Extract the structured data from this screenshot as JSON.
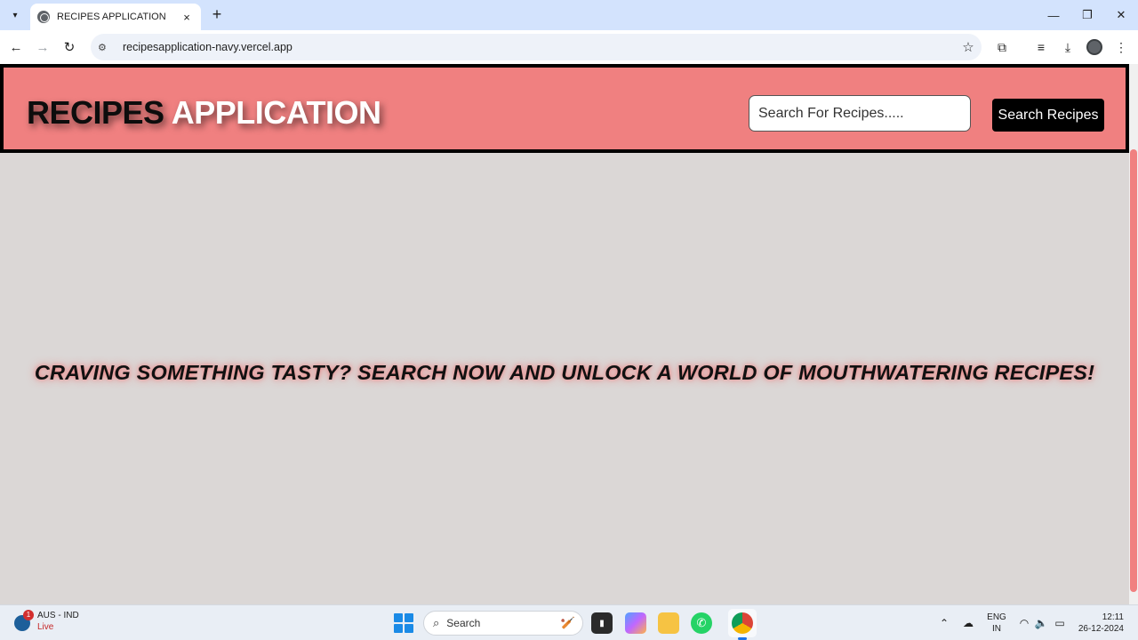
{
  "browser": {
    "tab_title": "RECIPES APPLICATION",
    "tab_close": "×",
    "new_tab": "+",
    "url": "recipesapplication-navy.vercel.app",
    "icons": [
      "tab-list-icon",
      "globe-icon",
      "back-icon",
      "forward-icon",
      "reload-icon",
      "site-settings-icon",
      "star-icon",
      "extensions-icon",
      "media-icon",
      "download-icon",
      "profile-icon",
      "menu-icon",
      "minimize-icon",
      "maximize-icon",
      "close-icon"
    ]
  },
  "app": {
    "brand_part1": "RECIPES",
    "brand_part2": "APPLICATION",
    "search_placeholder": "Search For Recipes.....",
    "search_button": "Search Recipes",
    "tagline": "CRAVING SOMETHING TASTY? SEARCH NOW AND UNLOCK A WORLD OF MOUTHWATERING RECIPES!",
    "colors": {
      "header_bg": "#f08080",
      "page_bg": "#dbd7d6",
      "button_bg": "#000000",
      "brand_dark": "#0d0d0d",
      "brand_light": "#ffffff"
    }
  },
  "taskbar": {
    "widget_badge": "1",
    "widget_title": "AUS - IND",
    "widget_status": "Live",
    "search_label": "Search",
    "language_line1": "ENG",
    "language_line2": "IN",
    "time": "12:11",
    "date": "26-12-2024",
    "apps": [
      "start-icon",
      "terminal-icon",
      "copilot-icon",
      "file-explorer-icon",
      "whatsapp-icon",
      "chrome-icon"
    ],
    "tray_icons": [
      "chevron-up-icon",
      "onedrive-icon",
      "wifi-icon",
      "volume-icon",
      "battery-icon"
    ]
  }
}
